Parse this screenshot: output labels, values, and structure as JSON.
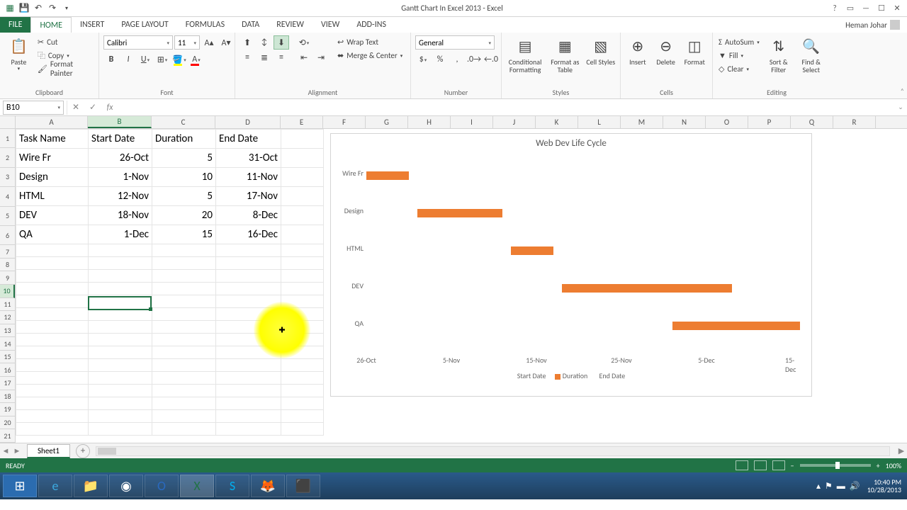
{
  "app": {
    "title": "Gantt Chart In Excel 2013 - Excel",
    "user": "Heman Johar"
  },
  "tabs": [
    "FILE",
    "HOME",
    "INSERT",
    "PAGE LAYOUT",
    "FORMULAS",
    "DATA",
    "REVIEW",
    "VIEW",
    "ADD-INS"
  ],
  "ribbon": {
    "clipboard": {
      "paste": "Paste",
      "cut": "Cut",
      "copy": "Copy",
      "fmtpainter": "Format Painter",
      "label": "Clipboard"
    },
    "font": {
      "name": "Calibri",
      "size": "11",
      "label": "Font"
    },
    "align": {
      "wrap": "Wrap Text",
      "merge": "Merge & Center",
      "label": "Alignment"
    },
    "number": {
      "fmt": "General",
      "label": "Number"
    },
    "styles": {
      "cond": "Conditional Formatting",
      "table": "Format as Table",
      "cell": "Cell Styles",
      "label": "Styles"
    },
    "cells": {
      "insert": "Insert",
      "delete": "Delete",
      "format": "Format",
      "label": "Cells"
    },
    "editing": {
      "sum": "AutoSum",
      "fill": "Fill",
      "clear": "Clear",
      "sort": "Sort & Filter",
      "find": "Find & Select",
      "label": "Editing"
    }
  },
  "namebox": "B10",
  "columns": [
    "A",
    "B",
    "C",
    "D",
    "E",
    "F",
    "G",
    "H",
    "I",
    "J",
    "K",
    "L",
    "M",
    "N",
    "O",
    "P",
    "Q",
    "R"
  ],
  "sheet_data": {
    "headers": [
      "Task Name",
      "Start Date",
      "Duration",
      "End Date"
    ],
    "rows": [
      {
        "task": "Wire Fr",
        "start": "26-Oct",
        "dur": "5",
        "end": "31-Oct"
      },
      {
        "task": "Design",
        "start": "1-Nov",
        "dur": "10",
        "end": "11-Nov"
      },
      {
        "task": "HTML",
        "start": "12-Nov",
        "dur": "5",
        "end": "17-Nov"
      },
      {
        "task": "DEV",
        "start": "18-Nov",
        "dur": "20",
        "end": "8-Dec"
      },
      {
        "task": "QA",
        "start": "1-Dec",
        "dur": "15",
        "end": "16-Dec"
      }
    ]
  },
  "chart_data": {
    "type": "bar",
    "title": "Web Dev Life Cycle",
    "categories": [
      "Wire Fr",
      "Design",
      "HTML",
      "DEV",
      "QA"
    ],
    "series": [
      {
        "name": "Start Date",
        "values": [
          "26-Oct",
          "1-Nov",
          "12-Nov",
          "18-Nov",
          "1-Dec"
        ],
        "offset_days": [
          0,
          6,
          17,
          23,
          36
        ]
      },
      {
        "name": "Duration",
        "values": [
          5,
          10,
          5,
          20,
          15
        ]
      },
      {
        "name": "End Date",
        "values": [
          "31-Oct",
          "11-Nov",
          "17-Nov",
          "8-Dec",
          "16-Dec"
        ]
      }
    ],
    "x_ticks": [
      "26-Oct",
      "5-Nov",
      "15-Nov",
      "25-Nov",
      "5-Dec",
      "15-Dec"
    ],
    "x_range_days": 50,
    "legend": [
      "Start Date",
      "Duration",
      "End Date"
    ]
  },
  "sheet_tab": "Sheet1",
  "status": {
    "ready": "READY",
    "zoom": "100%"
  },
  "tray": {
    "time": "10:40 PM",
    "date": "10/28/2013"
  }
}
